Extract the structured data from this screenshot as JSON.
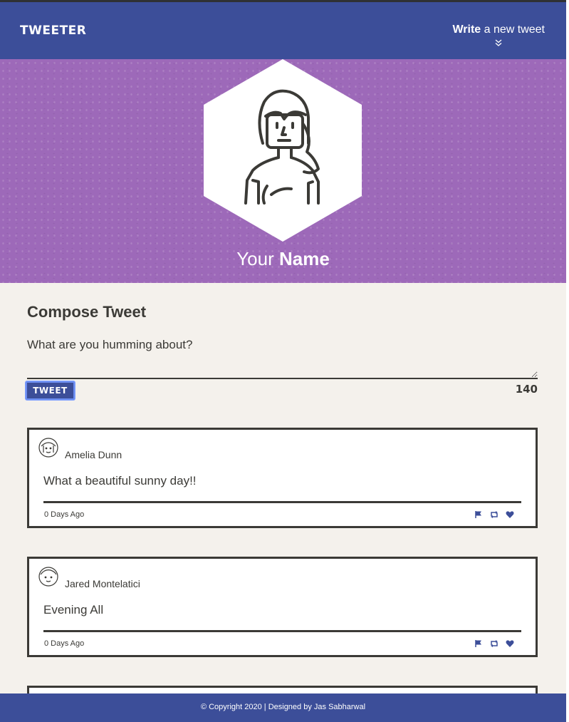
{
  "nav": {
    "brand": "TWEETER",
    "write_bold": "Write",
    "write_rest": " a new tweet",
    "chevron_icon": "double-chevron-down-icon"
  },
  "profile": {
    "name_light": "Your ",
    "name_bold": "Name",
    "avatar_icon": "user-avatar-icon"
  },
  "compose": {
    "title": "Compose Tweet",
    "placeholder": "What are you humming about?",
    "button_label": "TWEET",
    "counter": "140"
  },
  "tweets": [
    {
      "author": "Amelia Dunn",
      "content": "What a beautiful sunny day!!",
      "time": "0 Days Ago",
      "icons": [
        "flag-icon",
        "retweet-icon",
        "heart-icon"
      ]
    },
    {
      "author": "Jared Montelatici",
      "content": "Evening All",
      "time": "0 Days Ago",
      "icons": [
        "flag-icon",
        "retweet-icon",
        "heart-icon"
      ]
    }
  ],
  "footer": {
    "text": "© Copyright 2020 | Designed by Jas Sabharwal"
  },
  "colors": {
    "nav": "#3c4e99",
    "hero": "#9d69b9",
    "background": "#f4f1ec",
    "text": "#3b3a36"
  }
}
